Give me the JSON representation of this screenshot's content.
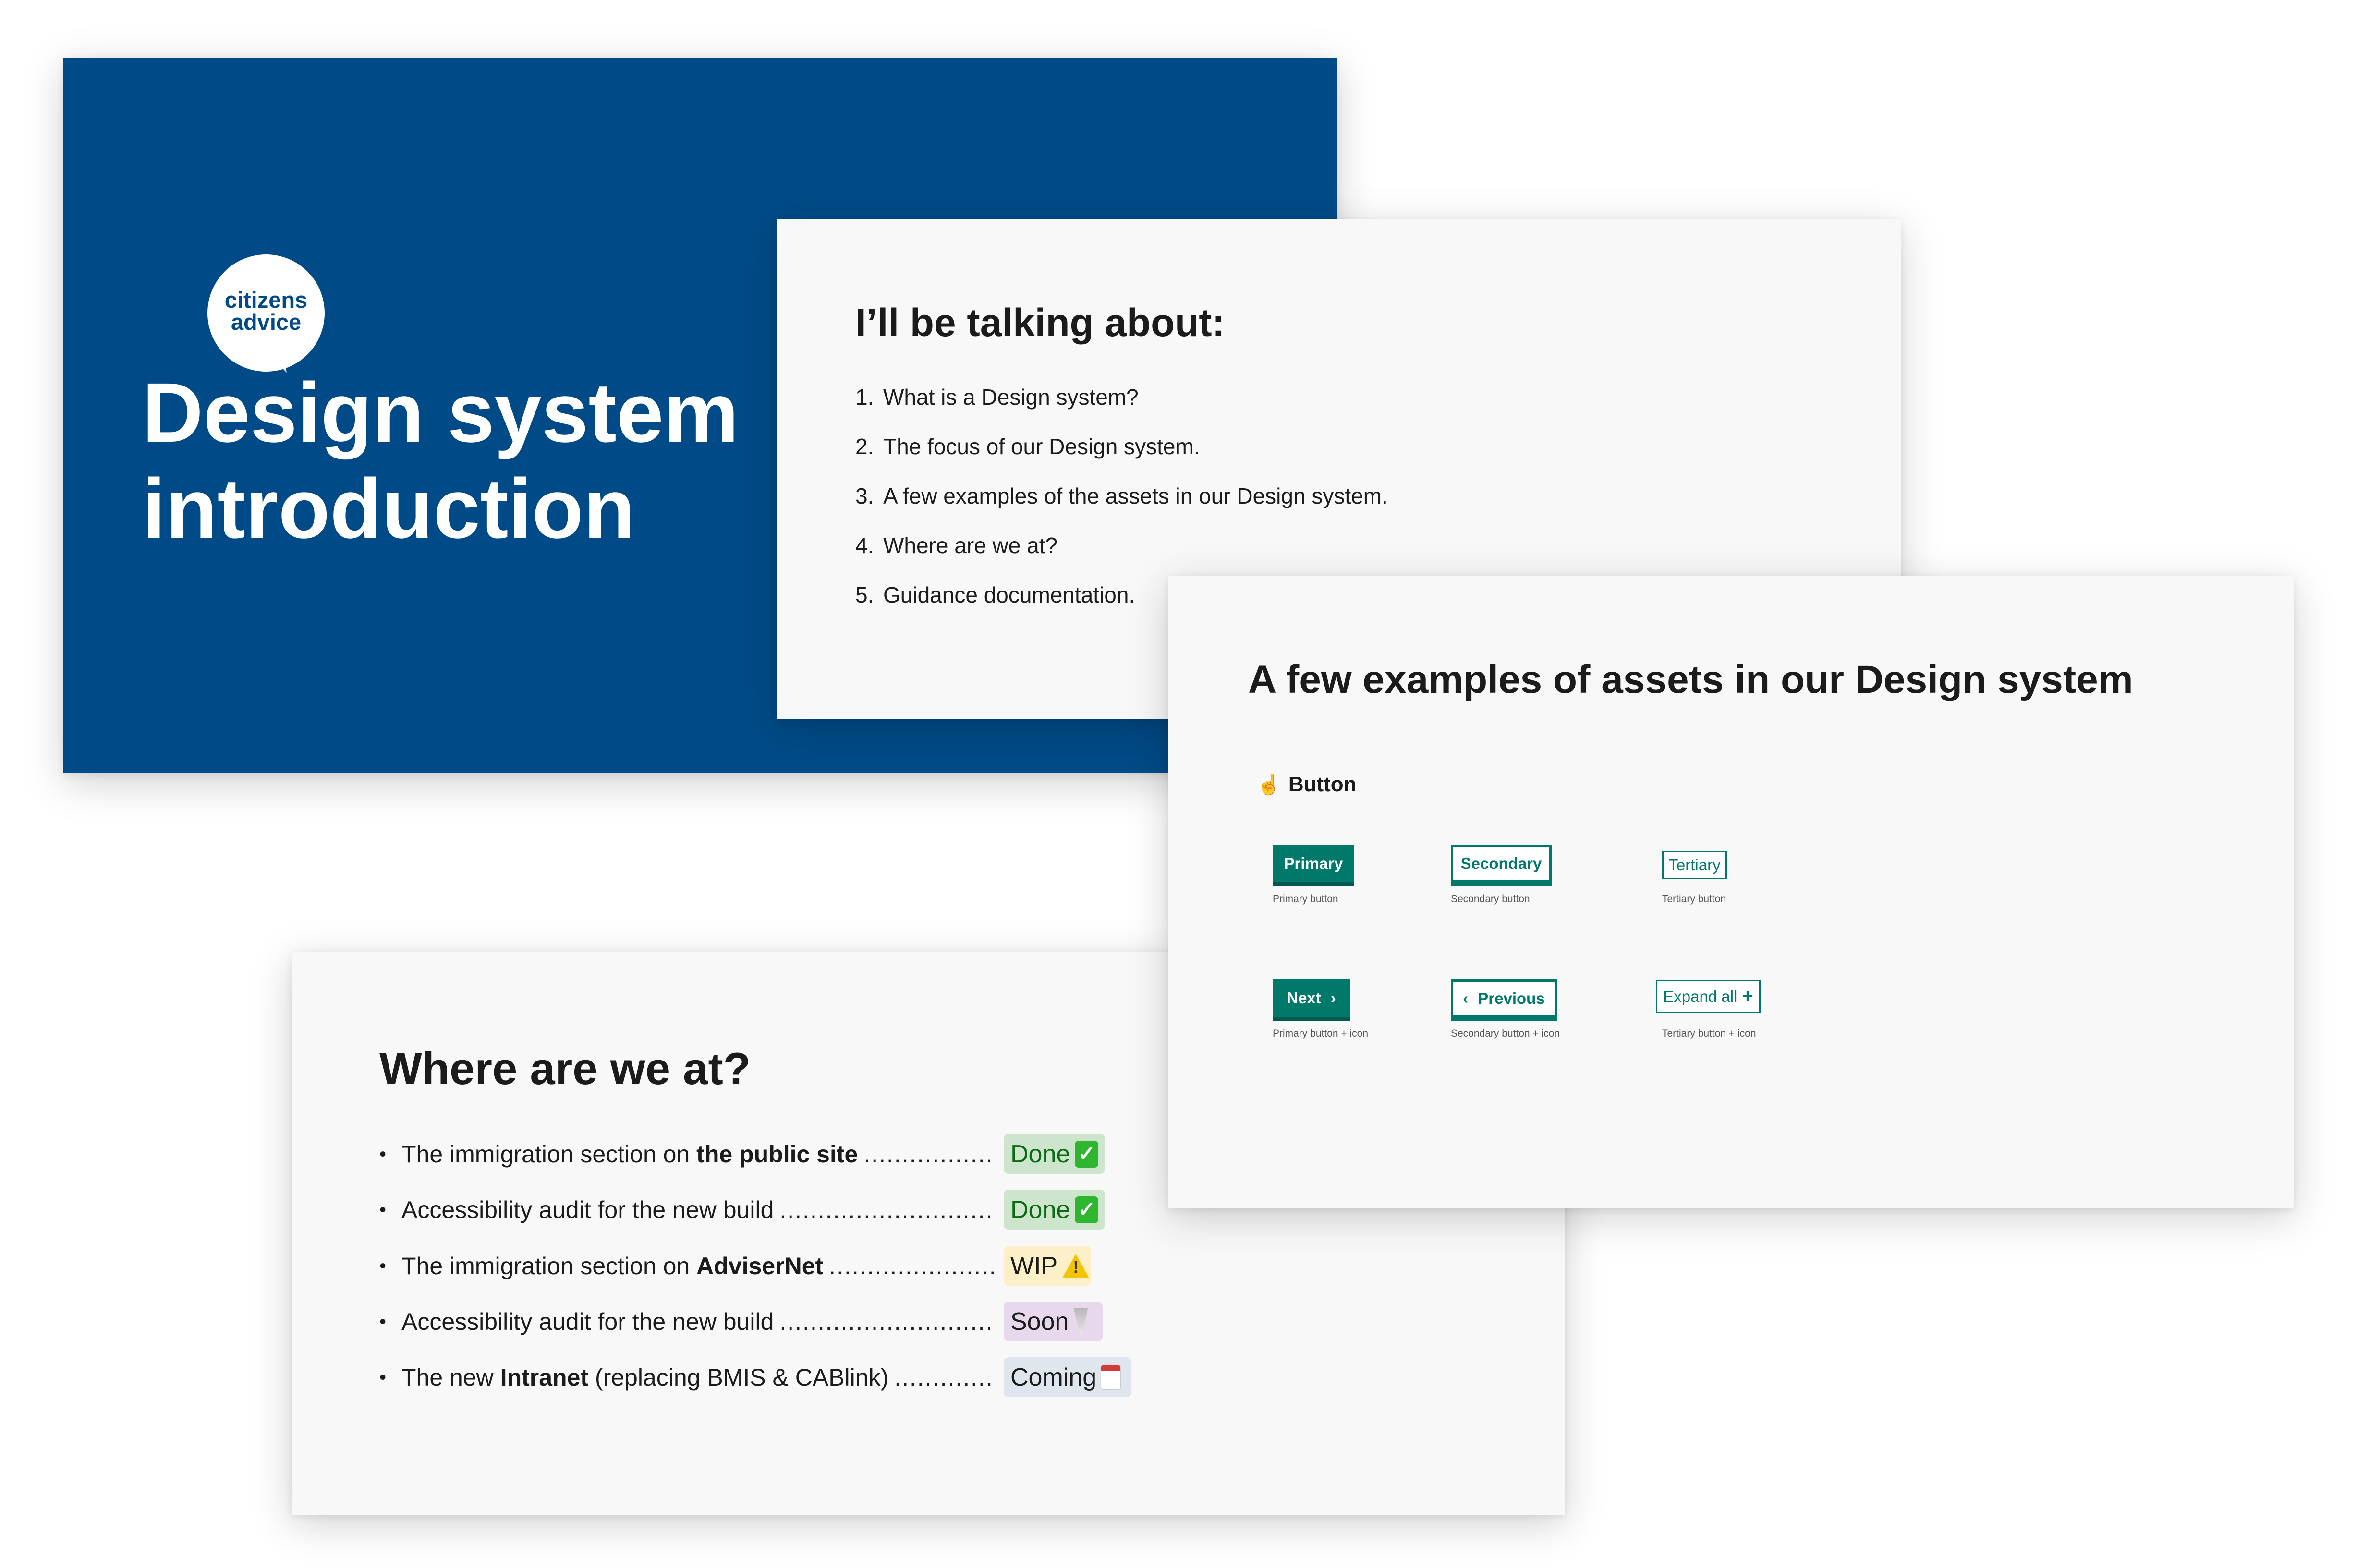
{
  "title_slide": {
    "logo_text": [
      "citizens",
      "advice"
    ],
    "title_lines": [
      "Design system",
      "introduction"
    ],
    "background_color": "#004b87"
  },
  "agenda_slide": {
    "heading": "I’ll be talking about:",
    "items": [
      {
        "num": "1.",
        "text": "What is a Design system?"
      },
      {
        "num": "2.",
        "text": "The focus of our Design system."
      },
      {
        "num": "3.",
        "text": "A few examples of the assets in our Design system."
      },
      {
        "num": "4.",
        "text": "Where are we at?"
      },
      {
        "num": "5.",
        "text": "Guidance documentation."
      }
    ]
  },
  "examples_slide": {
    "heading": "A few examples of assets in our Design system",
    "section_icon": "pointing-up-hand-icon",
    "section_title": "Button",
    "accent_color": "#00796b",
    "buttons": [
      {
        "label": "Primary",
        "caption": "Primary button"
      },
      {
        "label": "Secondary",
        "caption": "Secondary button"
      },
      {
        "label": "Tertiary",
        "caption": "Tertiary button"
      },
      {
        "label": "Next",
        "icon": "chevron-right-icon",
        "caption": "Primary button + icon"
      },
      {
        "label": "Previous",
        "icon": "chevron-left-icon",
        "caption": "Secondary button + icon"
      },
      {
        "label": "Expand all",
        "icon": "plus-icon",
        "caption": "Tertiary button + icon"
      }
    ]
  },
  "where_slide": {
    "heading": "Where are we at?",
    "items": [
      {
        "pre": "The immigration section on ",
        "bold": "the public site",
        "post": "",
        "status": "Done",
        "status_icon": "check-mark-icon",
        "status_color": "#cce5cc"
      },
      {
        "pre": "Accessibility audit for the new build",
        "bold": "",
        "post": "",
        "status": "Done",
        "status_icon": "check-mark-icon",
        "status_color": "#cce5cc"
      },
      {
        "pre": "The immigration section on ",
        "bold": "AdviserNet",
        "post": "",
        "status": "WIP",
        "status_icon": "warning-icon",
        "status_color": "#fdf0c8"
      },
      {
        "pre": "Accessibility audit for the new build",
        "bold": "",
        "post": "",
        "status": "Soon",
        "status_icon": "tornado-icon",
        "status_color": "#e8d8ec"
      },
      {
        "pre": "The new ",
        "bold": "Intranet",
        "post": " (replacing BMIS & CABlink)",
        "status": "Coming",
        "status_icon": "calendar-icon",
        "status_color": "#e0e6ee"
      }
    ]
  }
}
